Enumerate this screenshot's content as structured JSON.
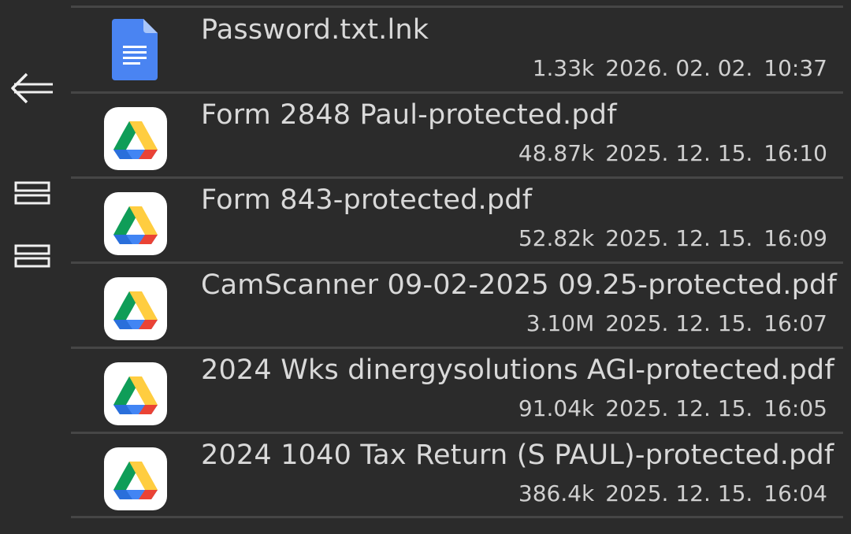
{
  "sidebar": {
    "buttons": [
      {
        "name": "back-arrow-icon"
      },
      {
        "name": "menu-icon"
      },
      {
        "name": "menu-icon"
      }
    ]
  },
  "files": [
    {
      "name": "Password.txt.lnk",
      "size": "1.33k",
      "date": "2026. 02. 02.",
      "time": "10:37",
      "icon": "google-docs-icon"
    },
    {
      "name": "Form 2848 Paul-protected.pdf",
      "size": "48.87k",
      "date": "2025. 12. 15.",
      "time": "16:10",
      "icon": "google-drive-icon"
    },
    {
      "name": "Form 843-protected.pdf",
      "size": "52.82k",
      "date": "2025. 12. 15.",
      "time": "16:09",
      "icon": "google-drive-icon"
    },
    {
      "name": "CamScanner 09-02-2025 09.25-protected.pdf",
      "size": "3.10M",
      "date": "2025. 12. 15.",
      "time": "16:07",
      "icon": "google-drive-icon"
    },
    {
      "name": "2024 Wks dinergysolutions AGI-protected.pdf",
      "size": "91.04k",
      "date": "2025. 12. 15.",
      "time": "16:05",
      "icon": "google-drive-icon"
    },
    {
      "name": "2024 1040 Tax Return (S PAUL)-protected.pdf",
      "size": "386.4k",
      "date": "2025. 12. 15.",
      "time": "16:04",
      "icon": "google-drive-icon"
    }
  ]
}
